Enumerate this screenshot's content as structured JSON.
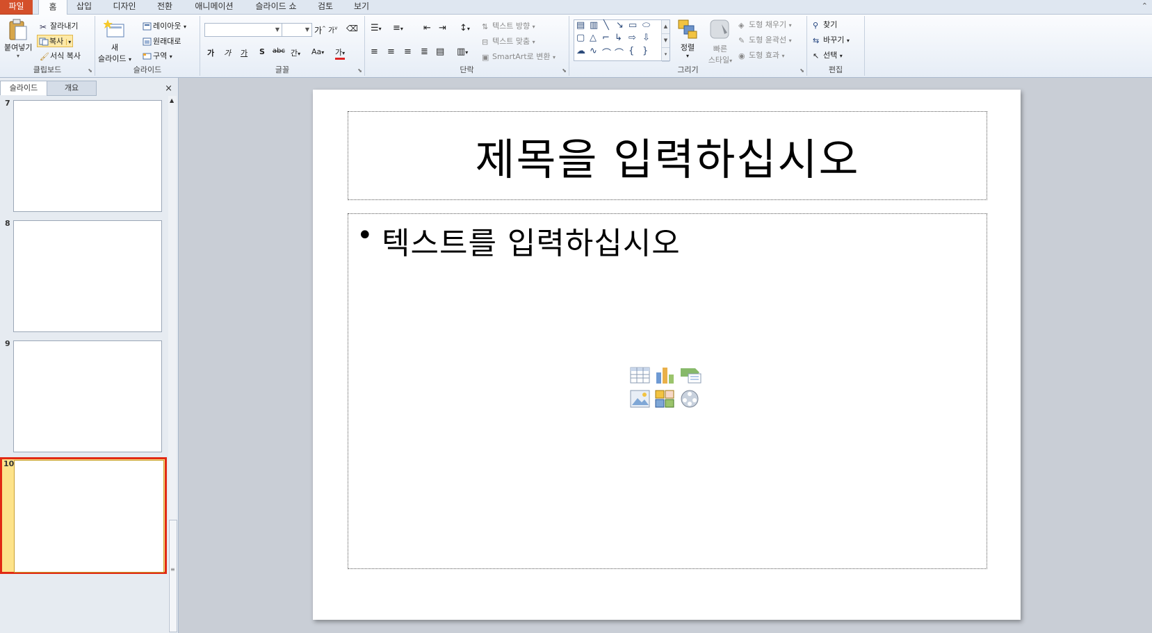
{
  "tabs": {
    "file": "파일",
    "home": "홈",
    "insert": "삽입",
    "design": "디자인",
    "transitions": "전환",
    "animations": "애니메이션",
    "slideshow": "슬라이드 쇼",
    "review": "검토",
    "view": "보기"
  },
  "ribbon": {
    "clipboard": {
      "label": "클립보드",
      "paste": "붙여넣기",
      "cut": "잘라내기",
      "copy": "복사",
      "format_painter": "서식 복사"
    },
    "slides": {
      "label": "슬라이드",
      "new_line1": "새",
      "new_line2": "슬라이드",
      "layout": "레이아웃",
      "reset": "원래대로",
      "section": "구역"
    },
    "font": {
      "label": "글꼴",
      "font_name": "",
      "font_size": "",
      "grow": "가",
      "shrink": "가",
      "bold": "가",
      "italic": "가",
      "underline": "가",
      "shadow": "S",
      "strike": "abc",
      "spacing": "간",
      "case": "Aa",
      "color": "가"
    },
    "paragraph": {
      "label": "단락",
      "text_direction": "텍스트 방향",
      "align_text": "텍스트 맞춤",
      "smartart": "SmartArt로 변환"
    },
    "drawing": {
      "label": "그리기",
      "arrange": "정렬",
      "quick_styles_line1": "빠른",
      "quick_styles_line2": "스타일",
      "shape_fill": "도형 채우기",
      "shape_outline": "도형 윤곽선",
      "shape_effects": "도형 효과"
    },
    "editing": {
      "label": "편집",
      "find": "찾기",
      "replace": "바꾸기",
      "select": "선택"
    }
  },
  "panel": {
    "tab_slides": "슬라이드",
    "tab_outline": "개요",
    "close": "×",
    "thumbnails": [
      {
        "number": "7"
      },
      {
        "number": "8"
      },
      {
        "number": "9"
      },
      {
        "number": "10",
        "selected": true
      }
    ]
  },
  "slide": {
    "title": "제목을 입력하십시오",
    "bullet": "•",
    "body": "텍스트를 입력하십시오"
  },
  "colors": {
    "file_tab": "#d44f2a",
    "selection_border": "#e12a14",
    "selection_fill": "#fde38a"
  },
  "icons": [
    "paste-icon",
    "cut-icon",
    "copy-icon",
    "format-painter-icon",
    "new-slide-icon",
    "layout-icon",
    "reset-icon",
    "section-icon",
    "bullets-icon",
    "numbering-icon",
    "text-direction-icon",
    "align-text-icon",
    "smartart-icon",
    "arrange-icon",
    "quick-styles-icon",
    "shape-fill-icon",
    "shape-outline-icon",
    "shape-effects-icon",
    "find-icon",
    "replace-icon",
    "select-icon",
    "insert-table-icon",
    "insert-chart-icon",
    "insert-smartart-icon",
    "insert-picture-icon",
    "insert-clipart-icon",
    "insert-media-icon"
  ]
}
